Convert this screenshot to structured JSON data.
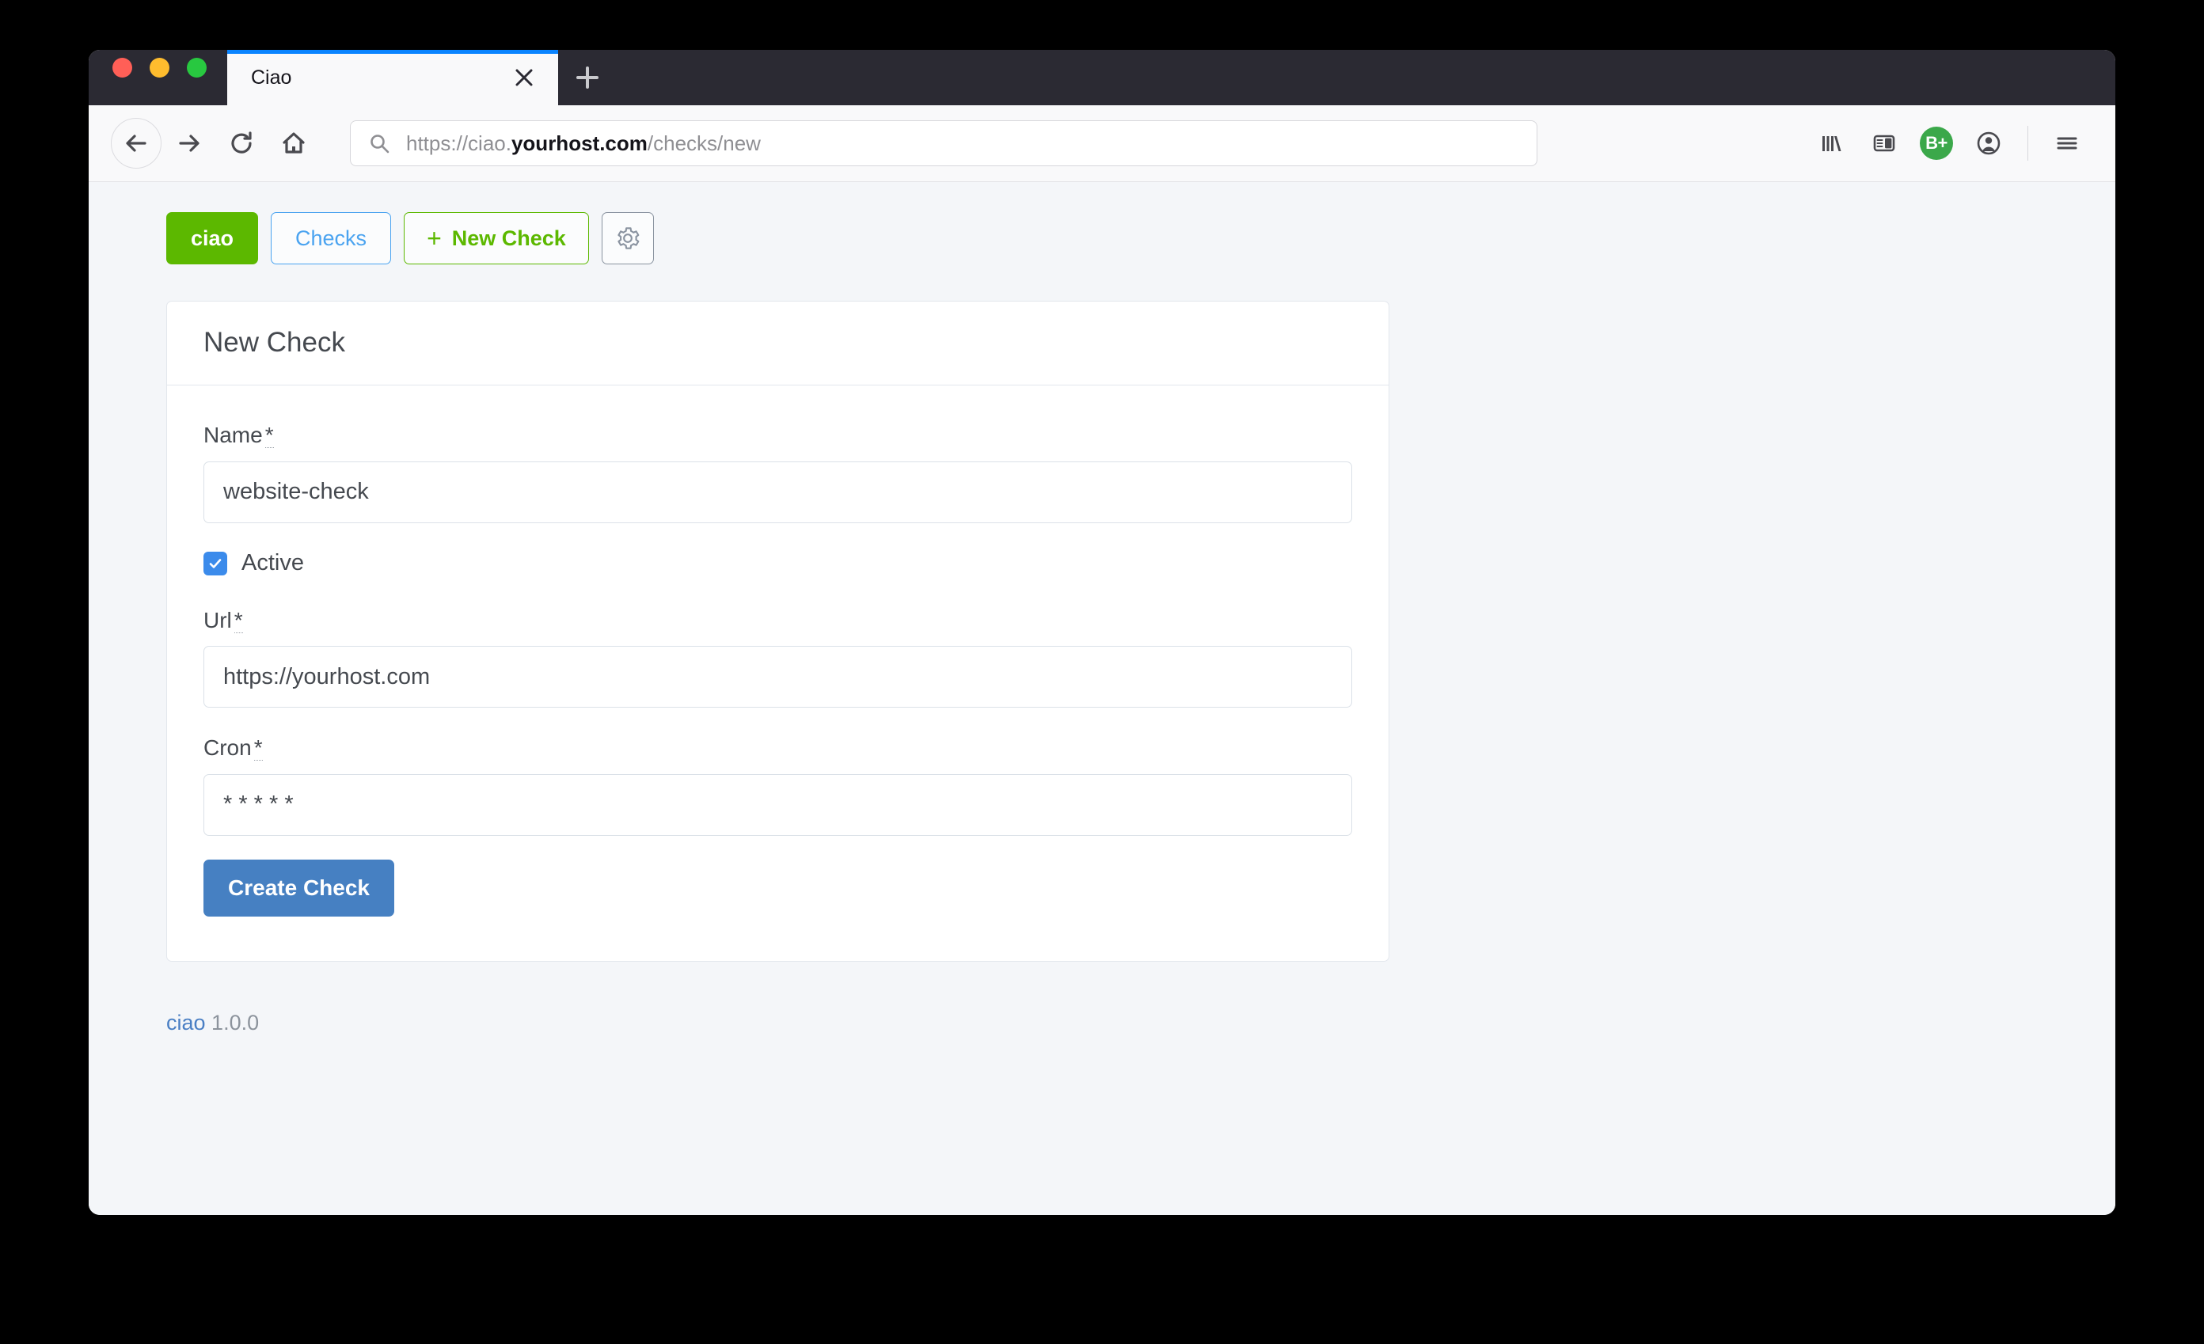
{
  "browser": {
    "tab": {
      "title": "Ciao",
      "close_icon": "close-icon"
    },
    "new_tab_label": "+",
    "url": {
      "prefix": "https://ciao.",
      "domain": "yourhost.com",
      "suffix": "/checks/new",
      "full": "https://ciao.yourhost.com/checks/new",
      "search_icon": "search-icon"
    },
    "nav_icons": [
      "back-icon",
      "forward-icon",
      "reload-icon",
      "home-icon"
    ],
    "toolbar_icons": [
      "library-icon",
      "sidebar-icon",
      "extension-badge-icon",
      "account-icon",
      "menu-icon"
    ],
    "extension_badge_label": "B+",
    "traffic_lights": [
      "close",
      "minimize",
      "maximize"
    ]
  },
  "app": {
    "nav": {
      "brand": "ciao",
      "checks_label": "Checks",
      "new_check_label": "New Check",
      "new_check_plus": "+",
      "settings_icon": "gear-icon"
    },
    "card": {
      "title": "New Check",
      "fields": [
        {
          "label": "Name",
          "required_marker": "*",
          "value": "website-check",
          "placeholder": ""
        },
        {
          "label": "Url",
          "required_marker": "*",
          "value": "https://yourhost.com",
          "placeholder": ""
        },
        {
          "label": "Cron",
          "required_marker": "*",
          "value": "* * * * *",
          "placeholder": ""
        }
      ],
      "checkbox": {
        "label": "Active",
        "checked": true
      },
      "submit_label": "Create Check"
    },
    "footer": {
      "link": "ciao",
      "version": "1.0.0"
    }
  },
  "colors": {
    "brand_green": "#5cb800",
    "link_blue": "#4aa3f0",
    "primary_blue": "#4680c2",
    "checkbox_blue": "#3b8beb",
    "page_bg": "#f4f6f9",
    "tabstrip": "#2b2a33",
    "tab_accent": "#0a84ff"
  }
}
